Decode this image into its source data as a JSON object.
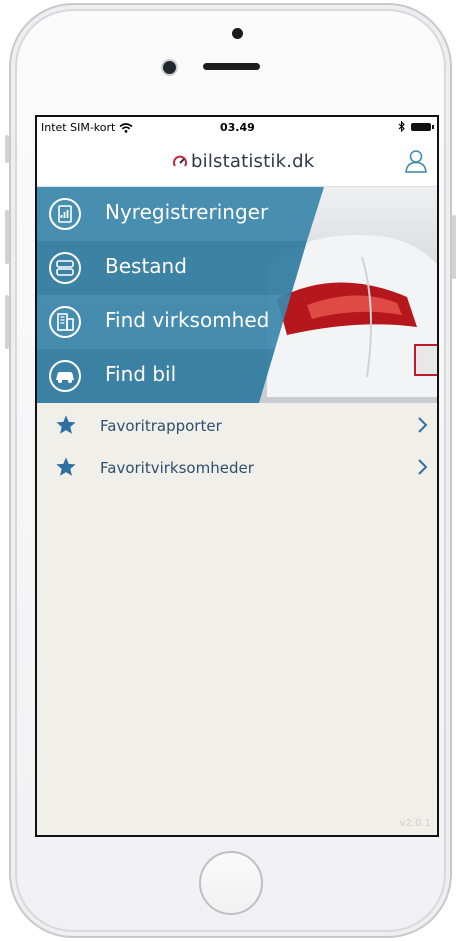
{
  "status_bar": {
    "carrier": "Intet SIM-kort",
    "time": "03.49"
  },
  "brand": {
    "logo_text": "bilstatistik.dk",
    "accent": "#3b86ab",
    "dark": "#2f3a45"
  },
  "menu": {
    "items": [
      {
        "label": "Nyregistreringer",
        "icon": "report-chart-icon"
      },
      {
        "label": "Bestand",
        "icon": "car-stock-icon"
      },
      {
        "label": "Find virksomhed",
        "icon": "company-building-icon"
      },
      {
        "label": "Find bil",
        "icon": "car-icon"
      }
    ]
  },
  "favorites": {
    "items": [
      {
        "label": "Favoritrapporter"
      },
      {
        "label": "Favoritvirksomheder"
      }
    ]
  },
  "version": "v2.0.1"
}
